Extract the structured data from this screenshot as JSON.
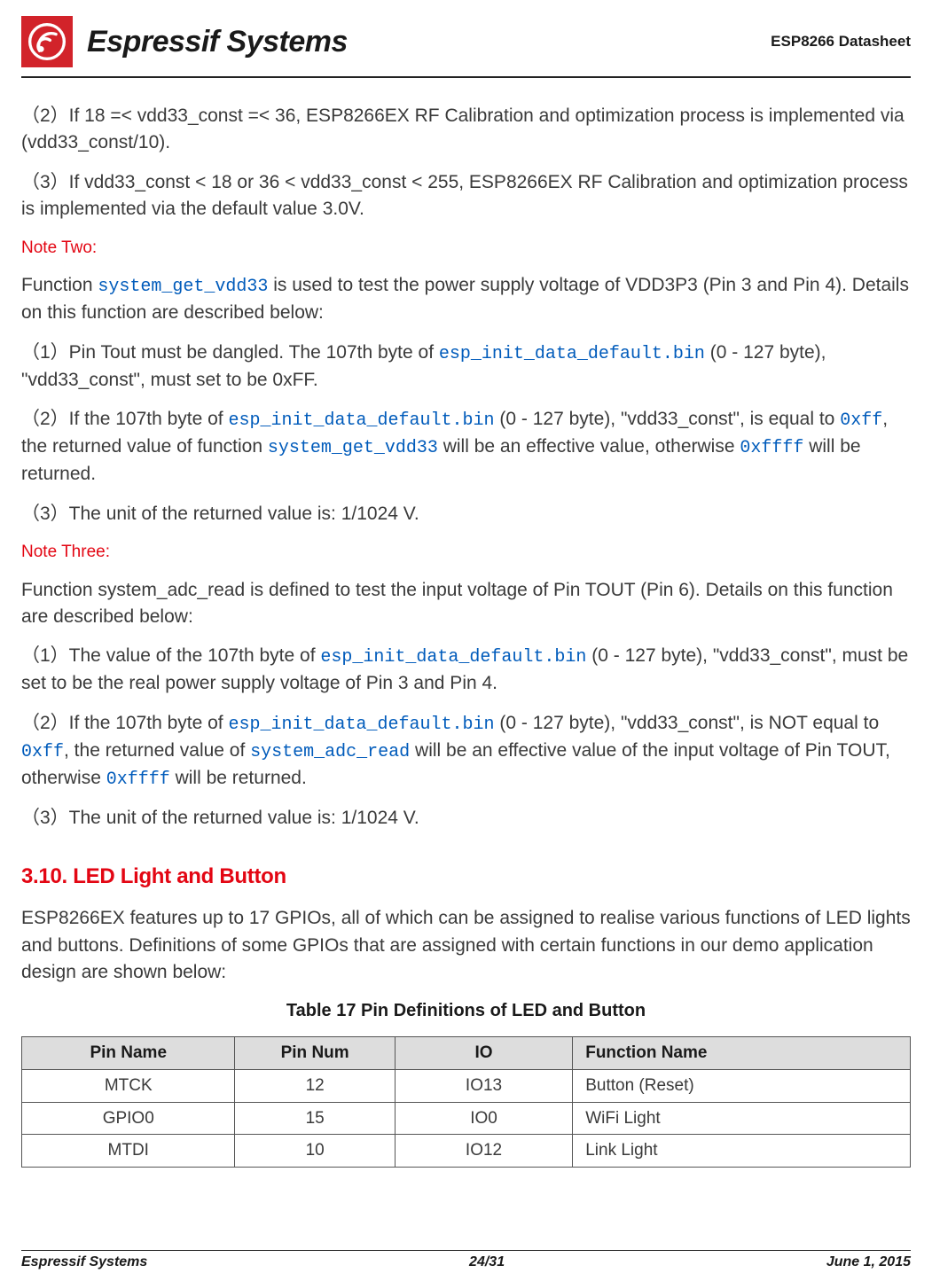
{
  "header": {
    "brand": "Espressif Systems",
    "doc_title": "ESP8266  Datasheet"
  },
  "body": {
    "p1_a": "（2）If 18 =< vdd33_const =< 36, ESP8266EX RF Calibration and optimization process is implemented via (vdd33_const/10).",
    "p1_b": "（3）If vdd33_const < 18 or 36 < vdd33_const < 255, ESP8266EX RF Calibration and optimization process is implemented via the default value 3.0V.",
    "note2_head": "Note Two:",
    "n2_intro_a": "Function ",
    "n2_intro_code": "system_get_vdd33",
    "n2_intro_b": " is used to test the power supply voltage of VDD3P3 (Pin 3 and Pin 4). Details on this function are described below:",
    "n2_p1_a": "（1）Pin Tout must be dangled. The 107th byte of ",
    "n2_p1_code": "esp_init_data_default.bin",
    "n2_p1_b": " (0 - 127 byte), \"vdd33_const\", must set to be 0xFF.",
    "n2_p2_a": "（2）If the 107th byte of ",
    "n2_p2_code1": "esp_init_data_default.bin",
    "n2_p2_b": " (0 - 127 byte), \"vdd33_const\", is equal to ",
    "n2_p2_code2": "0xff",
    "n2_p2_c": ", the returned value of function ",
    "n2_p2_code3": "system_get_vdd33",
    "n2_p2_d": " will be an effective value, otherwise ",
    "n2_p2_code4": "0xffff",
    "n2_p2_e": " will be returned.",
    "n2_p3": "（3）The unit of the returned value is: 1/1024 V.",
    "note3_head": "Note Three:",
    "n3_intro": "Function system_adc_read is defined to test the input voltage of Pin TOUT (Pin 6). Details on this function are described below:",
    "n3_p1_a": "（1）The value of the 107th byte of ",
    "n3_p1_code": "esp_init_data_default.bin",
    "n3_p1_b": " (0 - 127 byte), \"vdd33_const\", must be set to be the real power supply voltage of Pin 3 and Pin 4.",
    "n3_p2_a": "（2）If the 107th byte of ",
    "n3_p2_code1": "esp_init_data_default.bin",
    "n3_p2_b": " (0 - 127 byte), \"vdd33_const\", is NOT equal to ",
    "n3_p2_code2": "0xff",
    "n3_p2_c": ", the returned value of ",
    "n3_p2_code3": "system_adc_read",
    "n3_p2_d": " will be an effective value of the input voltage of Pin TOUT, otherwise ",
    "n3_p2_code4": "0xffff",
    "n3_p2_e": " will be returned.",
    "n3_p3": "（3）The unit of the returned value is: 1/1024 V.",
    "sec_head": "3.10.    LED Light and Button",
    "sec_intro": "ESP8266EX features up to 17 GPIOs, all of which can be assigned to realise various functions of LED lights and buttons. Definitions of some GPIOs that are assigned with certain functions in our demo application design are shown below:",
    "tbl_caption": "Table 17   Pin Definitions of LED and Button"
  },
  "table": {
    "headers": [
      "Pin Name",
      "Pin Num",
      "IO",
      "Function Name"
    ],
    "rows": [
      [
        "MTCK",
        "12",
        "IO13",
        "Button (Reset)"
      ],
      [
        "GPIO0",
        "15",
        "IO0",
        "WiFi  Light"
      ],
      [
        "MTDI",
        "10",
        "IO12",
        "Link  Light"
      ]
    ]
  },
  "footer": {
    "left": "Espressif Systems",
    "page": "24/31",
    "date": "June 1, 2015"
  }
}
